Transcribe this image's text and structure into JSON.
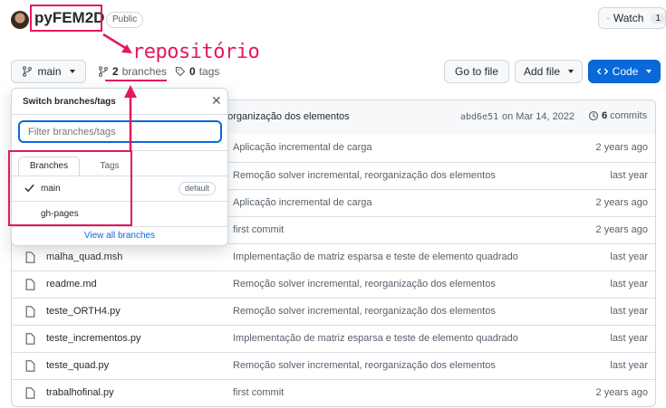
{
  "repo": {
    "name": "pyFEM2D",
    "visibility": "Public"
  },
  "watch": {
    "label": "Watch",
    "count": "1"
  },
  "annotation": {
    "label": "repositório",
    "color": "#e5175a"
  },
  "branch_bar": {
    "current_branch": "main",
    "branches_count": "2",
    "branches_label": "branches",
    "tags_count": "0",
    "tags_label": "tags"
  },
  "actions": {
    "go_to_file": "Go to file",
    "add_file": "Add file",
    "code": "Code"
  },
  "commit_bar": {
    "message": "eorganização dos elementos",
    "sha": "abd6e51",
    "date": "on Mar 14, 2022",
    "commits_count": "6",
    "commits_label": "commits"
  },
  "popup": {
    "title": "Switch branches/tags",
    "filter_placeholder": "Filter branches/tags",
    "tabs": [
      "Branches",
      "Tags"
    ],
    "branches": [
      {
        "name": "main",
        "badge": "default"
      },
      {
        "name": "gh-pages",
        "badge": ""
      }
    ],
    "view_all": "View all branches"
  },
  "files": [
    {
      "name": "",
      "message": "Aplicação incremental de carga",
      "age": "2 years ago"
    },
    {
      "name": "",
      "message": "Remoção solver incremental, reorganização dos elementos",
      "age": "last year"
    },
    {
      "name": "",
      "message": "Aplicação incremental de carga",
      "age": "2 years ago"
    },
    {
      "name": "",
      "message": "first commit",
      "age": "2 years ago"
    },
    {
      "name": "malha_quad.msh",
      "message": "Implementação de matriz esparsa e teste de elemento quadrado",
      "age": "last year"
    },
    {
      "name": "readme.md",
      "message": "Remoção solver incremental, reorganização dos elementos",
      "age": "last year"
    },
    {
      "name": "teste_ORTH4.py",
      "message": "Remoção solver incremental, reorganização dos elementos",
      "age": "last year"
    },
    {
      "name": "teste_incrementos.py",
      "message": "Implementação de matriz esparsa e teste de elemento quadrado",
      "age": "last year"
    },
    {
      "name": "teste_quad.py",
      "message": "Remoção solver incremental, reorganização dos elementos",
      "age": "last year"
    },
    {
      "name": "trabalhofinal.py",
      "message": "first commit",
      "age": "2 years ago"
    }
  ],
  "colors": {
    "code_button": "#0969da",
    "link": "#0969da",
    "annotation": "#e5175a"
  }
}
